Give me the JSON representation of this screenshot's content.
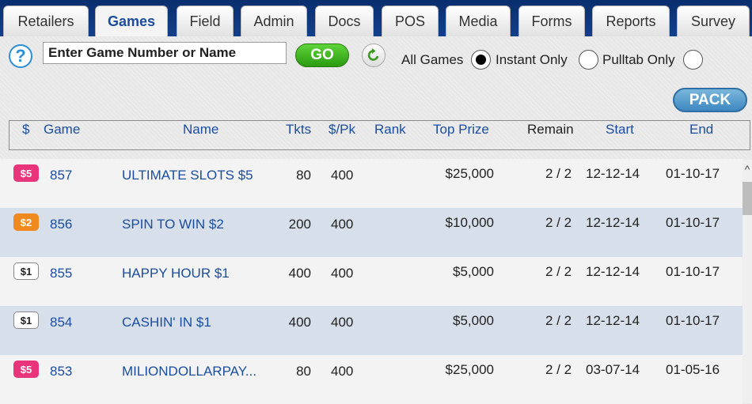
{
  "tabs": [
    "Retailers",
    "Games",
    "Field",
    "Admin",
    "Docs",
    "POS",
    "Media",
    "Forms",
    "Reports",
    "Survey"
  ],
  "active_tab": "Games",
  "toolbar": {
    "help_icon": "?",
    "search_placeholder": "Enter Game Number or Name",
    "go_label": "GO",
    "refresh_icon": "refresh-icon",
    "filters": [
      "All Games",
      "Instant Only",
      "Pulltab Only"
    ],
    "selected_filter": "All Games",
    "pack_label": "PACK"
  },
  "table": {
    "headers": [
      "$",
      "Game",
      "Name",
      "Tkts",
      "$/Pk",
      "Rank",
      "Top Prize",
      "Remain",
      "Start",
      "End"
    ],
    "rows": [
      {
        "price": "$5",
        "badge_color": "#e8347a",
        "game": "857",
        "name": "ULTIMATE SLOTS $5",
        "tkts": "80",
        "per_pack": "400",
        "rank": "",
        "top_prize": "$25,000",
        "remain": "2 / 2",
        "start": "12-12-14",
        "end": "01-10-17"
      },
      {
        "price": "$2",
        "badge_color": "#f08a1e",
        "game": "856",
        "name": "SPIN TO WIN $2",
        "tkts": "200",
        "per_pack": "400",
        "rank": "",
        "top_prize": "$10,000",
        "remain": "2 / 2",
        "start": "12-12-14",
        "end": "01-10-17"
      },
      {
        "price": "$1",
        "badge_color": "#ffffff",
        "game": "855",
        "name": "HAPPY HOUR $1",
        "tkts": "400",
        "per_pack": "400",
        "rank": "",
        "top_prize": "$5,000",
        "remain": "2 / 2",
        "start": "12-12-14",
        "end": "01-10-17"
      },
      {
        "price": "$1",
        "badge_color": "#ffffff",
        "game": "854",
        "name": "CASHIN' IN $1",
        "tkts": "400",
        "per_pack": "400",
        "rank": "",
        "top_prize": "$5,000",
        "remain": "2 / 2",
        "start": "12-12-14",
        "end": "01-10-17"
      },
      {
        "price": "$5",
        "badge_color": "#e8347a",
        "game": "853",
        "name": "MILIONDOLLARPAY...",
        "tkts": "80",
        "per_pack": "400",
        "rank": "",
        "top_prize": "$25,000",
        "remain": "2 / 2",
        "start": "03-07-14",
        "end": "01-05-16"
      }
    ]
  },
  "scrollbar": {
    "up_icon": "^"
  }
}
